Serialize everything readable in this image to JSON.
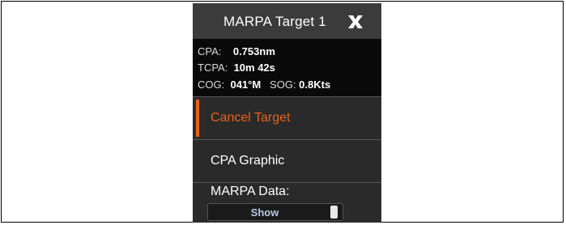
{
  "dialog": {
    "title": "MARPA Target 1",
    "close_icon": "close-x-icon"
  },
  "info": {
    "cpa_label": "CPA:",
    "cpa_value": "0.753nm",
    "tcpa_label": "TCPA:",
    "tcpa_value": "10m 42s",
    "cog_label": "COG:",
    "cog_value": "041°M",
    "sog_label": "SOG:",
    "sog_value": "0.8Kts"
  },
  "menu": {
    "items": [
      {
        "label": "Cancel Target",
        "selected": true
      },
      {
        "label": "CPA Graphic",
        "selected": false
      }
    ]
  },
  "marpa_data": {
    "label": "MARPA Data:",
    "toggle_value": "Show"
  },
  "colors": {
    "accent": "#e8621a",
    "panel": "#2a2a2a",
    "titlebar": "#3b3b3b",
    "info_bg": "#0a0a0a",
    "toggle_text": "#b8c9e6"
  }
}
